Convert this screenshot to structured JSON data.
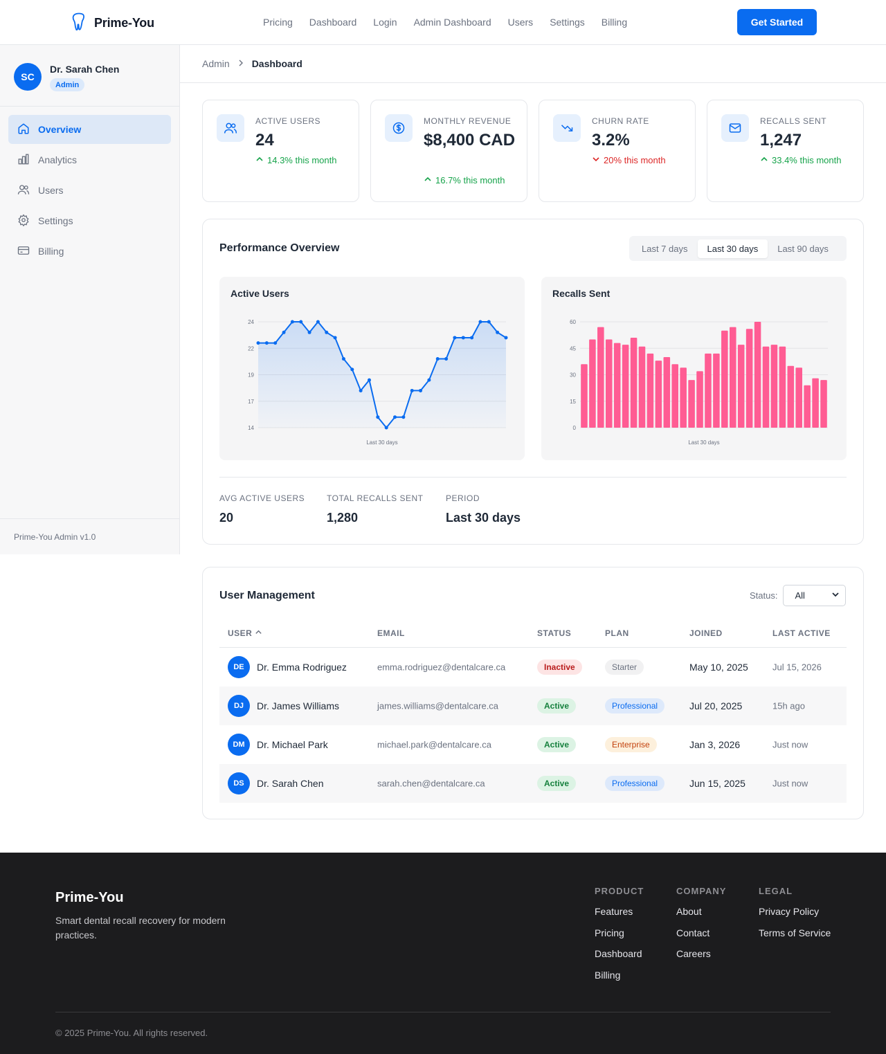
{
  "header": {
    "brand": "Prime-You",
    "nav": [
      "Pricing",
      "Dashboard",
      "Login",
      "Admin Dashboard",
      "Users",
      "Settings",
      "Billing"
    ],
    "cta": "Get Started"
  },
  "sidebar": {
    "initials": "SC",
    "name": "Dr. Sarah Chen",
    "role": "Admin",
    "items": [
      {
        "label": "Overview",
        "icon": "home-icon",
        "active": true
      },
      {
        "label": "Analytics",
        "icon": "bar-chart-icon"
      },
      {
        "label": "Users",
        "icon": "users-icon"
      },
      {
        "label": "Settings",
        "icon": "gear-icon"
      },
      {
        "label": "Billing",
        "icon": "credit-card-icon"
      }
    ],
    "footer": "Prime-You Admin v1.0"
  },
  "breadcrumb": {
    "root": "Admin",
    "current": "Dashboard"
  },
  "stats": [
    {
      "label": "Active Users",
      "value": "24",
      "trend": "14.3% this month",
      "direction": "up",
      "icon": "users-icon"
    },
    {
      "label": "Monthly Revenue",
      "value": "$8,400 CAD",
      "trend": "16.7% this month",
      "direction": "up",
      "icon": "dollar-icon"
    },
    {
      "label": "Churn Rate",
      "value": "3.2%",
      "trend": "20% this month",
      "direction": "down",
      "icon": "trending-down-icon"
    },
    {
      "label": "Recalls Sent",
      "value": "1,247",
      "trend": "33.4% this month",
      "direction": "up",
      "icon": "mail-icon"
    }
  ],
  "performance": {
    "title": "Performance Overview",
    "ranges": [
      "Last 7 days",
      "Last 30 days",
      "Last 90 days"
    ],
    "active_range": "Last 30 days",
    "summary": [
      {
        "label": "Avg Active Users",
        "value": "20"
      },
      {
        "label": "Total Recalls Sent",
        "value": "1,280"
      },
      {
        "label": "Period",
        "value": "Last 30 days"
      }
    ]
  },
  "chart_data": [
    {
      "type": "area",
      "title": "Active Users",
      "xlabel": "Last 30 days",
      "ylabel": "",
      "ylim": [
        14,
        24
      ],
      "yticks": [
        "24",
        "22",
        "19",
        "17",
        "14"
      ],
      "color": "#0a6cf0",
      "values": [
        22,
        22,
        22,
        23,
        24,
        24,
        23,
        24,
        23,
        22.5,
        20.5,
        19.5,
        17.5,
        18.5,
        15,
        14,
        15,
        15,
        17.5,
        17.5,
        18.5,
        20.5,
        20.5,
        22.5,
        22.5,
        22.5,
        24,
        24,
        23,
        22.5
      ]
    },
    {
      "type": "bar",
      "title": "Recalls Sent",
      "xlabel": "Last 30 days",
      "ylabel": "",
      "ylim": [
        0,
        60
      ],
      "yticks": [
        "60",
        "45",
        "30",
        "15",
        "0"
      ],
      "color": "#ff5c93",
      "values": [
        36,
        50,
        57,
        50,
        48,
        47,
        51,
        46,
        42,
        38,
        40,
        36,
        34,
        27,
        32,
        42,
        42,
        55,
        57,
        47,
        56,
        60,
        46,
        47,
        46,
        35,
        34,
        24,
        28,
        27
      ]
    }
  ],
  "users": {
    "title": "User Management",
    "filter_label": "Status:",
    "filter_value": "All",
    "columns": [
      "USER",
      "EMAIL",
      "STATUS",
      "PLAN",
      "JOINED",
      "LAST ACTIVE"
    ],
    "rows": [
      {
        "initials": "DE",
        "name": "Dr. Emma Rodriguez",
        "email": "emma.rodriguez@dentalcare.ca",
        "status": "Inactive",
        "plan": "Starter",
        "joined": "May 10, 2025",
        "last_active": "Jul 15, 2026"
      },
      {
        "initials": "DJ",
        "name": "Dr. James Williams",
        "email": "james.williams@dentalcare.ca",
        "status": "Active",
        "plan": "Professional",
        "joined": "Jul 20, 2025",
        "last_active": "15h ago"
      },
      {
        "initials": "DM",
        "name": "Dr. Michael Park",
        "email": "michael.park@dentalcare.ca",
        "status": "Active",
        "plan": "Enterprise",
        "joined": "Jan 3, 2026",
        "last_active": "Just now"
      },
      {
        "initials": "DS",
        "name": "Dr. Sarah Chen",
        "email": "sarah.chen@dentalcare.ca",
        "status": "Active",
        "plan": "Professional",
        "joined": "Jun 15, 2025",
        "last_active": "Just now"
      }
    ]
  },
  "footer": {
    "brand": "Prime-You",
    "tagline": "Smart dental recall recovery for modern practices.",
    "columns": [
      {
        "heading": "PRODUCT",
        "links": [
          "Features",
          "Pricing",
          "Dashboard",
          "Billing"
        ]
      },
      {
        "heading": "COMPANY",
        "links": [
          "About",
          "Contact",
          "Careers"
        ]
      },
      {
        "heading": "LEGAL",
        "links": [
          "Privacy Policy",
          "Terms of Service"
        ]
      }
    ],
    "copyright": "© 2025 Prime-You. All rights reserved."
  }
}
